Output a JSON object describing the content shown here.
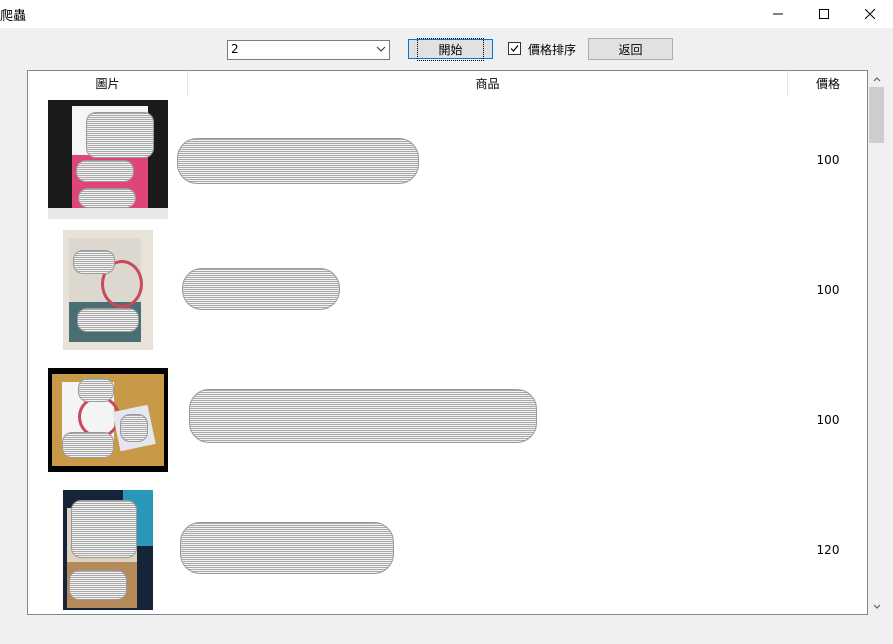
{
  "window": {
    "title": "爬蟲"
  },
  "toolbar": {
    "page_select_value": "2",
    "start_label": "開始",
    "sort_checked": true,
    "sort_label": "價格排序",
    "back_label": "返回"
  },
  "grid": {
    "columns": [
      "圖片",
      "商品",
      "價格"
    ],
    "rows": [
      {
        "price": "100"
      },
      {
        "price": "100"
      },
      {
        "price": "100"
      },
      {
        "price": "120"
      }
    ]
  },
  "icons": {
    "minimize": "minimize-icon",
    "maximize": "maximize-icon",
    "close": "close-icon",
    "dropdown": "chevron-down-icon",
    "check": "checkmark-icon"
  }
}
